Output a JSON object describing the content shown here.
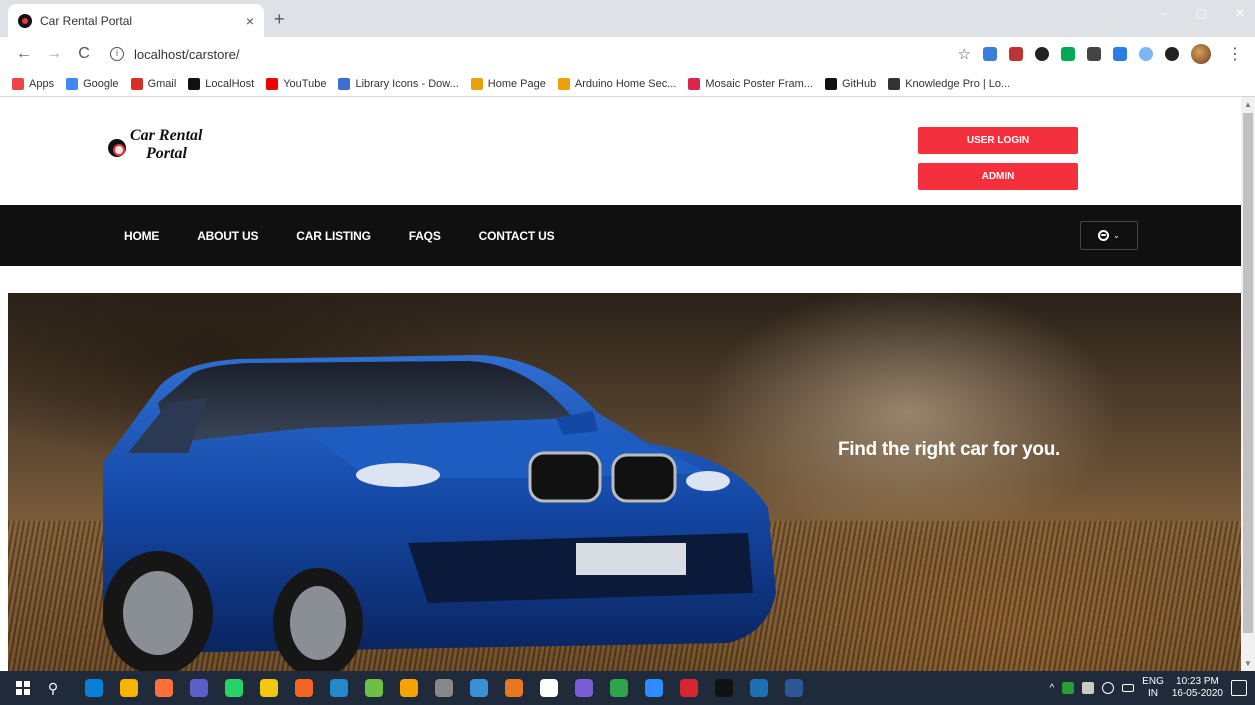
{
  "browser": {
    "tab_title": "Car Rental Portal",
    "tab_close": "×",
    "new_tab": "+",
    "url": "localhost/carstore/",
    "win_min": "–",
    "win_max": "▢",
    "win_close": "✕"
  },
  "bookmarks": [
    {
      "label": "Apps",
      "color": "#e44"
    },
    {
      "label": "Google",
      "color": "#4285f4"
    },
    {
      "label": "Gmail",
      "color": "#d93025"
    },
    {
      "label": "LocalHost",
      "color": "#111"
    },
    {
      "label": "YouTube",
      "color": "#e00"
    },
    {
      "label": "Library Icons - Dow...",
      "color": "#3b6fd6"
    },
    {
      "label": "Home Page",
      "color": "#e9a20a"
    },
    {
      "label": "Arduino Home Sec...",
      "color": "#e9a20a"
    },
    {
      "label": "Mosaic Poster Fram...",
      "color": "#d9264a"
    },
    {
      "label": "GitHub",
      "color": "#111"
    },
    {
      "label": "Knowledge Pro | Lo...",
      "color": "#333"
    }
  ],
  "site": {
    "logo_line1": "Car Rental",
    "logo_line2": "Portal",
    "user_login": "USER LOGIN",
    "admin": "ADMIN",
    "nav": [
      "HOME",
      "ABOUT US",
      "CAR LISTING",
      "FAQS",
      "CONTACT US"
    ],
    "hero_text": "Find the right car for you.",
    "brand_color": "#f5303d",
    "navbar_color": "#101010"
  },
  "taskbar": {
    "lang1": "ENG",
    "lang2": "IN",
    "time": "10:23 PM",
    "date": "16-05-2020",
    "apps": [
      "#0a7fd8",
      "#f4b400",
      "#ff7139",
      "#5b5fc7",
      "#25d366",
      "#f2c811",
      "#f26522",
      "#2489ca",
      "#6fbf44",
      "#f4a300",
      "#888",
      "#3a8fd6",
      "#e87722",
      "#fff",
      "#7b5cd6",
      "#2ea44f",
      "#2d8cff",
      "#d6262f",
      "#111",
      "#1f6fb5",
      "#2b5797"
    ]
  }
}
